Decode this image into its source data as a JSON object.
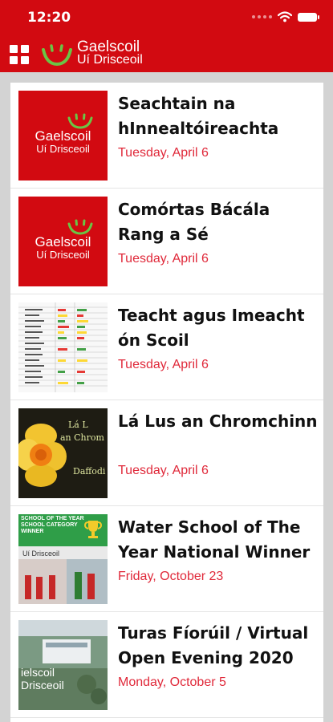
{
  "status_bar": {
    "time": "12:20"
  },
  "header": {
    "logo_name": "Gaelscoil",
    "logo_sub": "Uí Drisceoil",
    "colors": {
      "brand": "#d20a11",
      "date": "#e0293a"
    }
  },
  "icons": {
    "menu": "grid-menu-icon",
    "wifi": "wifi-icon",
    "battery": "battery-icon"
  },
  "items": [
    {
      "title": "Seachtain na hInnealtóireachta",
      "date": "Tuesday, April 6",
      "thumb": "logo"
    },
    {
      "title": "Comórtas Bácála Rang a Sé",
      "date": "Tuesday, April 6",
      "thumb": "logo"
    },
    {
      "title": "Teacht agus Imeacht ón Scoil",
      "date": "Tuesday, April 6",
      "thumb": "table"
    },
    {
      "title": "Lá Lus an Chromchinn",
      "date": "Tuesday, April 6",
      "thumb": "daffodil"
    },
    {
      "title": "Water School of The Year National Winner",
      "date": "Friday, October 23",
      "thumb": "water"
    },
    {
      "title": "Turas Fíorúil / Virtual Open Evening 2020",
      "date": "Monday, October 5",
      "thumb": "turas"
    }
  ],
  "thumb_text": {
    "logo_name": "Gaelscoil",
    "logo_sub": "Uí Drisceoil",
    "daff_line1": "Lá L",
    "daff_line2": "an Chrom",
    "daff_line3": "Daffodi",
    "water_line1": "SCHOOL OF THE YEAR",
    "water_line2": "SCHOOL CATEGORY",
    "water_line3": "WINNER",
    "water_sub": "Uí Drisceoil",
    "turas_line1": "ielscoil",
    "turas_line2": "Drisceoil"
  }
}
